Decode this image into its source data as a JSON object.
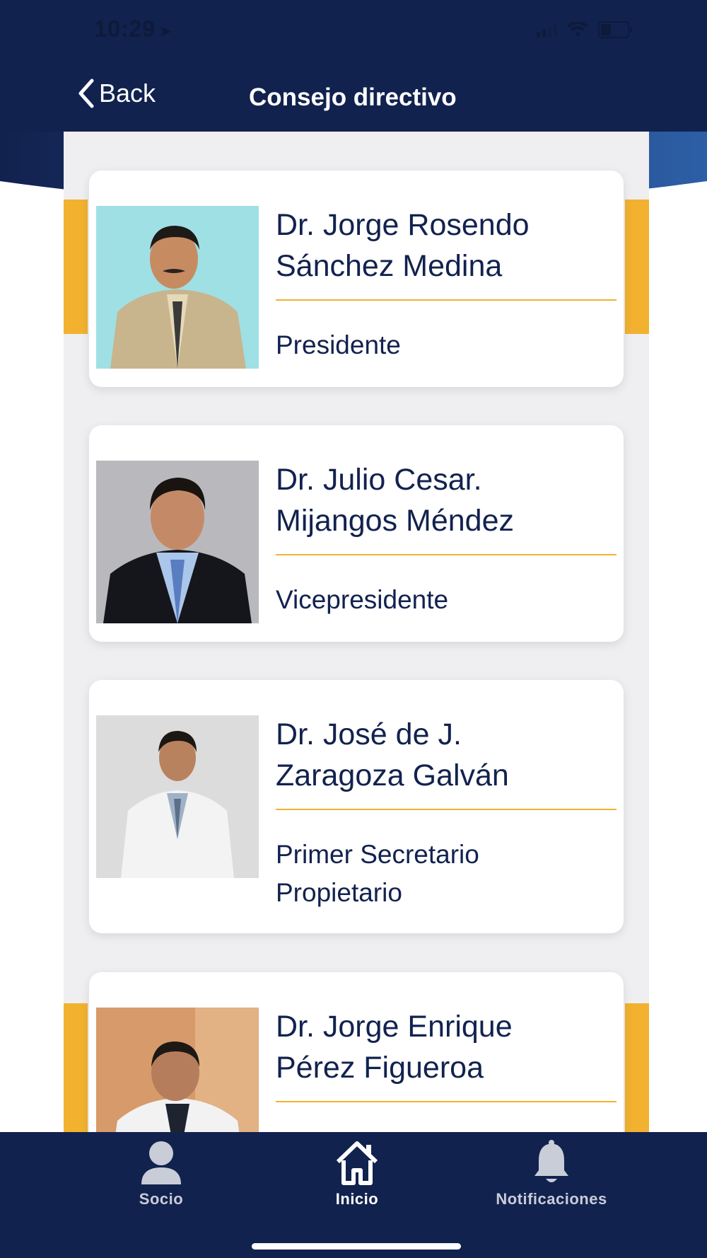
{
  "status_bar": {
    "time": "10:29",
    "location_glyph": "➤"
  },
  "nav": {
    "back_label": "Back",
    "title": "Consejo directivo"
  },
  "members": [
    {
      "name_line1": "Dr. Jorge Rosendo",
      "name_line2": "Sánchez Medina",
      "role_line1": "Presidente",
      "role_line2": ""
    },
    {
      "name_line1": "Dr. Julio Cesar.",
      "name_line2": "Mijangos Méndez",
      "role_line1": "Vicepresidente",
      "role_line2": ""
    },
    {
      "name_line1": "Dr. José de J.",
      "name_line2": "Zaragoza Galván",
      "role_line1": "Primer Secretario",
      "role_line2": "Propietario"
    },
    {
      "name_line1": "Dr. Jorge Enrique",
      "name_line2": "Pérez Figueroa",
      "role_line1": "",
      "role_line2": ""
    }
  ],
  "tabs": [
    {
      "label": "Socio",
      "icon": "person-icon"
    },
    {
      "label": "Inicio",
      "icon": "home-icon"
    },
    {
      "label": "Notificaciones",
      "icon": "bell-icon"
    }
  ],
  "active_tab": "Inicio",
  "colors": {
    "navy": "#12224f",
    "gold": "#f2b230",
    "banner_blue": "#2a5aa0"
  }
}
